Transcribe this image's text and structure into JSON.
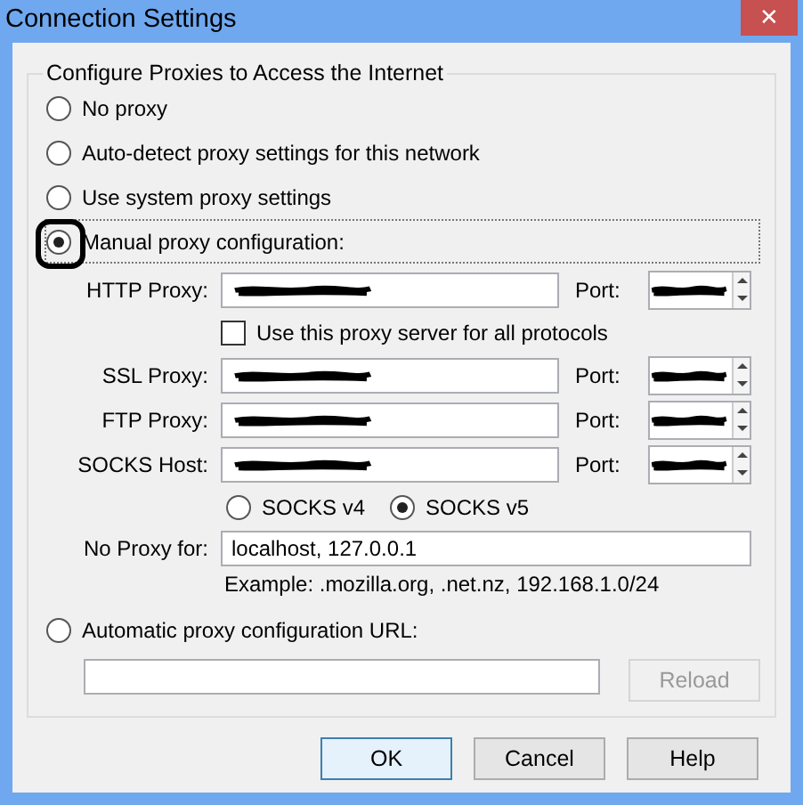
{
  "window": {
    "title": "Connection Settings",
    "close": "✕"
  },
  "group": {
    "title": "Configure Proxies to Access the Internet"
  },
  "modes": [
    {
      "label": "No proxy",
      "selected": false,
      "focused": false,
      "circled": false
    },
    {
      "label": "Auto-detect proxy settings for this network",
      "selected": false,
      "focused": false,
      "circled": false
    },
    {
      "label": "Use system proxy settings",
      "selected": false,
      "focused": false,
      "circled": false
    },
    {
      "label": "Manual proxy configuration:",
      "selected": true,
      "focused": true,
      "circled": true
    }
  ],
  "proxies": [
    {
      "kind": "proxy",
      "label": "HTTP Proxy:",
      "redacted": true,
      "port_label": "Port:",
      "port_redacted": true
    },
    {
      "kind": "checkbox",
      "label": "Use this proxy server for all protocols",
      "checked": false
    },
    {
      "kind": "proxy",
      "label": "SSL Proxy:",
      "redacted": true,
      "port_label": "Port:",
      "port_redacted": true
    },
    {
      "kind": "proxy",
      "label": "FTP Proxy:",
      "redacted": true,
      "port_label": "Port:",
      "port_redacted": true
    },
    {
      "kind": "proxy",
      "label": "SOCKS Host:",
      "redacted": true,
      "port_label": "Port:",
      "port_redacted": true
    }
  ],
  "socks_versions": [
    {
      "label": "SOCKS v4",
      "selected": false
    },
    {
      "label": "SOCKS v5",
      "selected": true
    }
  ],
  "no_proxy": {
    "label": "No Proxy for:",
    "value": "localhost, 127.0.0.1",
    "example": "Example: .mozilla.org, .net.nz, 192.168.1.0/24"
  },
  "auto_config": {
    "label": "Automatic proxy configuration URL:",
    "selected": false,
    "reload": "Reload",
    "reload_disabled": true
  },
  "buttons": [
    {
      "label": "OK",
      "default": true
    },
    {
      "label": "Cancel",
      "default": false
    },
    {
      "label": "Help",
      "default": false
    }
  ]
}
